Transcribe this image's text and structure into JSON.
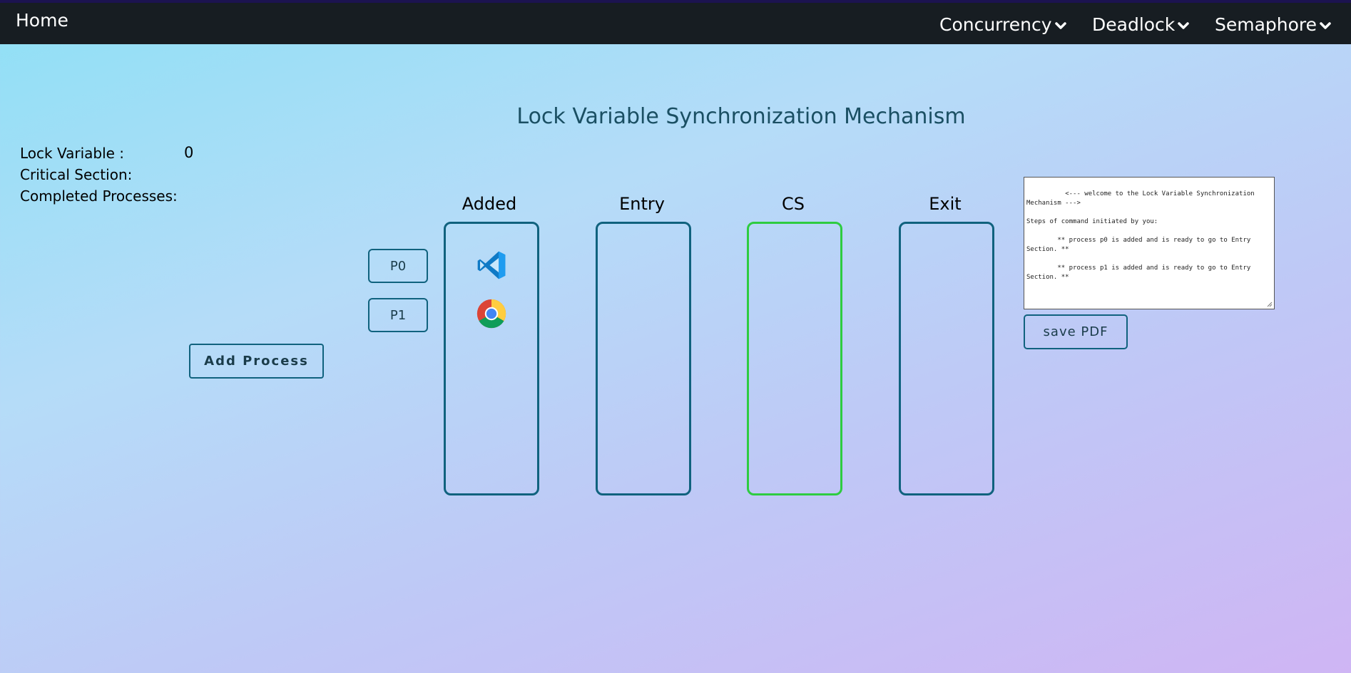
{
  "nav": {
    "home": "Home",
    "menus": [
      {
        "label": "Concurrency",
        "icon": "chevron-down-icon"
      },
      {
        "label": "Deadlock",
        "icon": "chevron-down-icon"
      },
      {
        "label": "Semaphore",
        "icon": "chevron-down-icon"
      }
    ]
  },
  "title": "Lock Variable Synchronization Mechanism",
  "info": {
    "lock_label": "Lock Variable :",
    "lock_value": "0",
    "critical_label": "Critical Section:",
    "completed_label": "Completed Processes:"
  },
  "columns": [
    {
      "label": "Added",
      "color": "#10627e"
    },
    {
      "label": "Entry",
      "color": "#10627e"
    },
    {
      "label": "CS",
      "color": "#2ecc40"
    },
    {
      "label": "Exit",
      "color": "#10627e"
    }
  ],
  "processes": [
    {
      "label": "P0",
      "icon": "vscode-icon"
    },
    {
      "label": "P1",
      "icon": "chrome-icon"
    }
  ],
  "buttons": {
    "add_process": "Add Process",
    "save_pdf": "save PDF"
  },
  "log": {
    "text": "        <--- welcome to the Lock Variable Synchronization Mechanism --->\n\nSteps of command initiated by you:\n\n        ** process p0 is added and is ready to go to Entry Section. **\n\n        ** process p1 is added and is ready to go to Entry Section. **"
  },
  "colors": {
    "navbar": "#171d22",
    "accent": "#10627e",
    "cs_border": "#2ecc40",
    "title": "#1a4f63"
  }
}
